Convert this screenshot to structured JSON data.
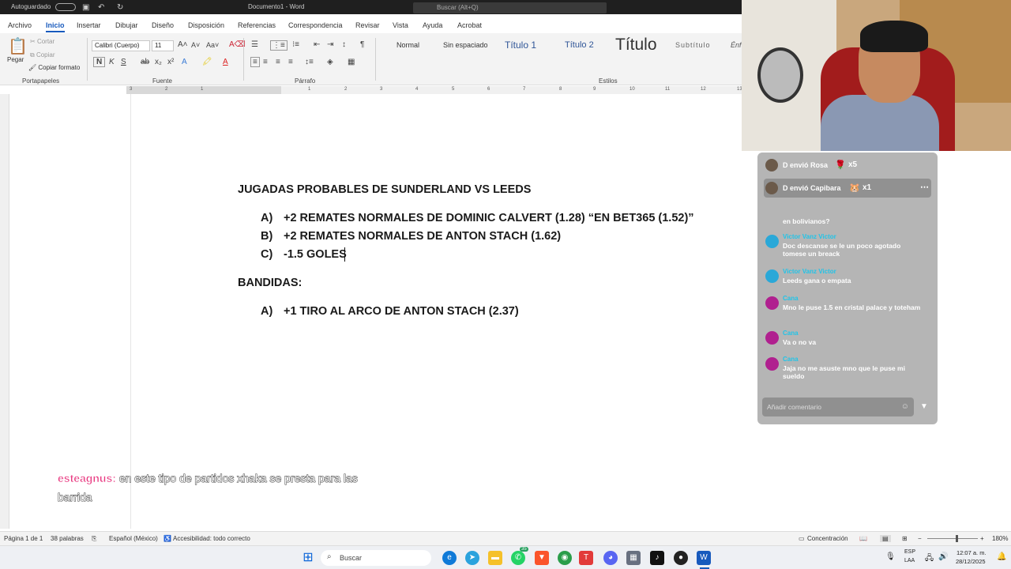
{
  "titlebar": {
    "autosave": "Autoguardado",
    "doc_title": "Documento1 - Word",
    "search_placeholder": "Buscar (Alt+Q)"
  },
  "tabs": [
    "Archivo",
    "Inicio",
    "Insertar",
    "Dibujar",
    "Diseño",
    "Disposición",
    "Referencias",
    "Correspondencia",
    "Revisar",
    "Vista",
    "Ayuda",
    "Acrobat"
  ],
  "active_tab": "Inicio",
  "ribbon": {
    "clipboard": {
      "paste": "Pegar",
      "cut": "Cortar",
      "copy": "Copiar",
      "format_painter": "Copiar formato",
      "label": "Portapapeles"
    },
    "font": {
      "name": "Calibri (Cuerpo)",
      "size": "11",
      "label": "Fuente"
    },
    "paragraph": {
      "label": "Párrafo"
    },
    "styles": {
      "items": [
        "Normal",
        "Sin espaciado",
        "Título 1",
        "Título 2",
        "Título",
        "Subtítulo",
        "Énf"
      ],
      "label": "Estilos"
    }
  },
  "ruler": [
    "3",
    "2",
    "1",
    "1",
    "2",
    "3",
    "4",
    "5",
    "6",
    "7",
    "8",
    "9",
    "10",
    "11",
    "12",
    "13",
    "14",
    "15"
  ],
  "document": {
    "heading1": "JUGADAS PROBABLES DE SUNDERLAND VS LEEDS",
    "list1": [
      {
        "letter": "A)",
        "text": "+2 REMATES NORMALES DE DOMINIC CALVERT (1.28) “EN BET365 (1.52)”"
      },
      {
        "letter": "B)",
        "text": "+2 REMATES NORMALES DE ANTON STACH (1.62)"
      },
      {
        "letter": "C)",
        "text": "-1.5 GOLES"
      }
    ],
    "heading2": "BANDIDAS:",
    "list2": [
      {
        "letter": "A)",
        "text": "+1 TIRO AL ARCO DE ANTON STACH (2.37)"
      }
    ]
  },
  "caption": {
    "user": "esteagnus:",
    "line1": "en este tipo de partidos xhaka se presta para las",
    "line2": "barrida"
  },
  "statusbar": {
    "page": "Página 1 de 1",
    "words": "38 palabras",
    "language": "Español (México)",
    "accessibility": "Accesibilidad: todo correcto",
    "focus": "Concentración",
    "zoom": "180%"
  },
  "taskbar": {
    "search": "Buscar",
    "lang1": "ESP",
    "lang2": "LAA",
    "time": "12:07 a. m.",
    "date": "28/12/2025",
    "badge": "35"
  },
  "chat": {
    "gifts": [
      {
        "text": "D envió Rosa",
        "count": "x5"
      },
      {
        "text": "D envió Capibara",
        "count": "x1"
      }
    ],
    "partial": "en bolivianos?",
    "messages": [
      {
        "name": "Victor Vanz Victor",
        "text": "Doc descanse se le un poco agotado tomese un breack",
        "color": "#2aa8d8"
      },
      {
        "name": "Victor Vanz Victor",
        "text": "Leeds gana o empata",
        "color": "#2aa8d8"
      },
      {
        "name": "Cana",
        "text": "Mno le puse 1.5 en cristal palace y toteham",
        "color": "#b0208f"
      },
      {
        "name": "Cana",
        "text": "Va o no va",
        "color": "#b0208f"
      },
      {
        "name": "Cana",
        "text": "Jaja no me asuste mno que le puse mi sueldo",
        "color": "#b0208f"
      }
    ],
    "comment_placeholder": "Añadir comentario"
  }
}
